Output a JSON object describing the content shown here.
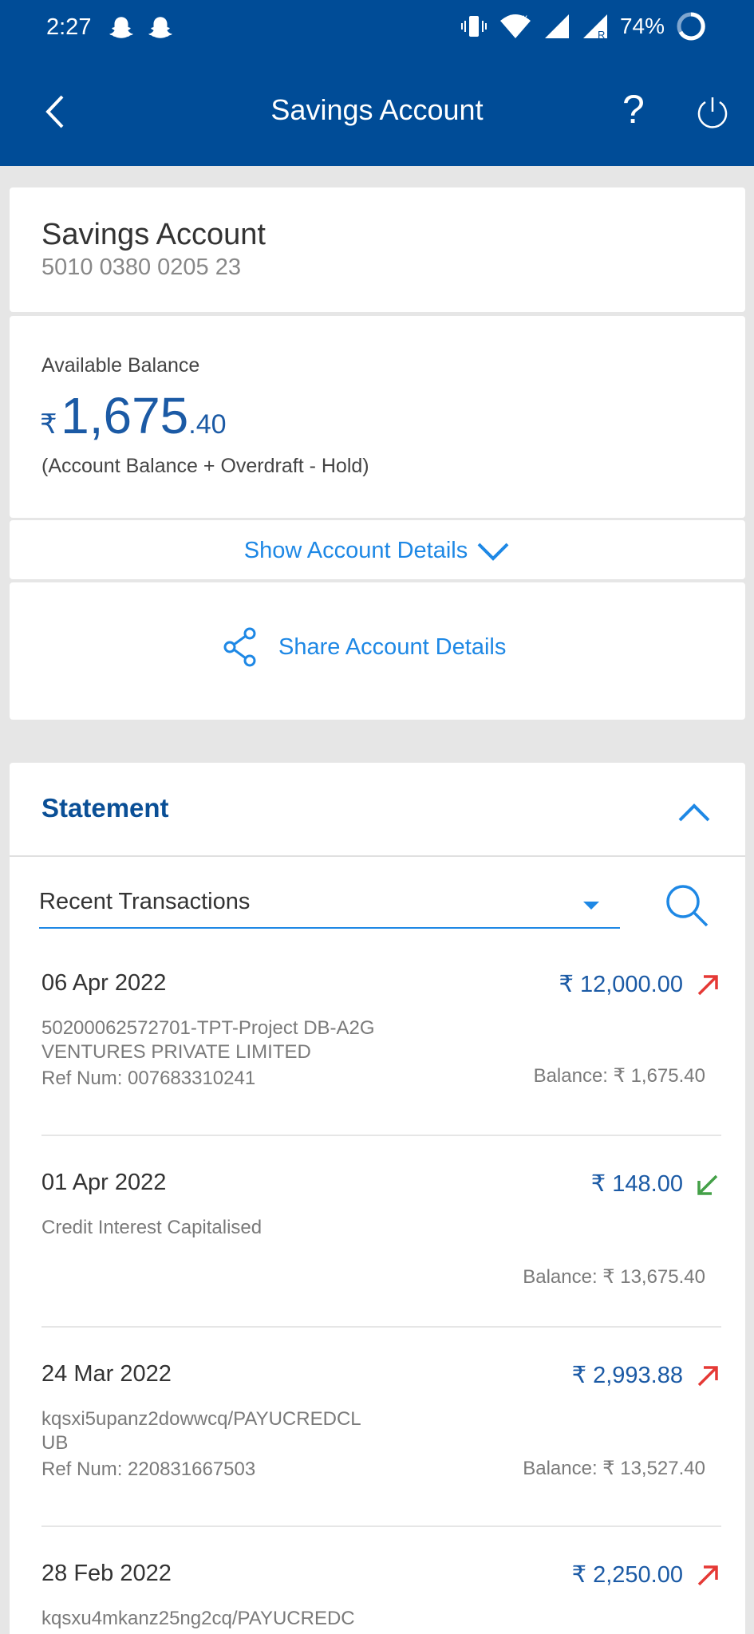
{
  "status": {
    "time": "2:27",
    "battery": "74%"
  },
  "header": {
    "title": "Savings Account",
    "help": "?"
  },
  "account": {
    "name": "Savings Account",
    "number": "5010 0380 0205 23",
    "balance_label": "Available Balance",
    "currency": "₹",
    "balance_int": "1,675",
    "balance_dec": ".40",
    "balance_note": "(Account Balance + Overdraft - Hold)",
    "show_details": "Show Account Details",
    "share_details": "Share Account Details"
  },
  "statement": {
    "title": "Statement",
    "filter": "Recent Transactions",
    "transactions": [
      {
        "date": "06 Apr 2022",
        "amount": "₹ 12,000.00",
        "direction": "debit",
        "desc": "50200062572701-TPT-Project DB-A2G VENTURES PRIVATE LIMITED",
        "ref": "Ref Num: 007683310241",
        "balance": "Balance:  ₹ 1,675.40"
      },
      {
        "date": "01 Apr 2022",
        "amount": "₹ 148.00",
        "direction": "credit",
        "desc": "Credit Interest Capitalised",
        "ref": "",
        "balance": "Balance:  ₹ 13,675.40"
      },
      {
        "date": "24 Mar 2022",
        "amount": "₹ 2,993.88",
        "direction": "debit",
        "desc": "kqsxi5upanz2dowwcq/PAYUCREDCLUB",
        "ref": "Ref Num: 220831667503",
        "balance": "Balance:  ₹ 13,527.40"
      },
      {
        "date": "28 Feb 2022",
        "amount": "₹ 2,250.00",
        "direction": "debit",
        "desc": "kqsxu4mkanz25ng2cq/PAYUCREDC",
        "ref": "",
        "balance": ""
      }
    ]
  },
  "colors": {
    "header": "#004c97",
    "accent": "#1e88e5",
    "debit": "#e53935",
    "credit": "#43a047"
  }
}
